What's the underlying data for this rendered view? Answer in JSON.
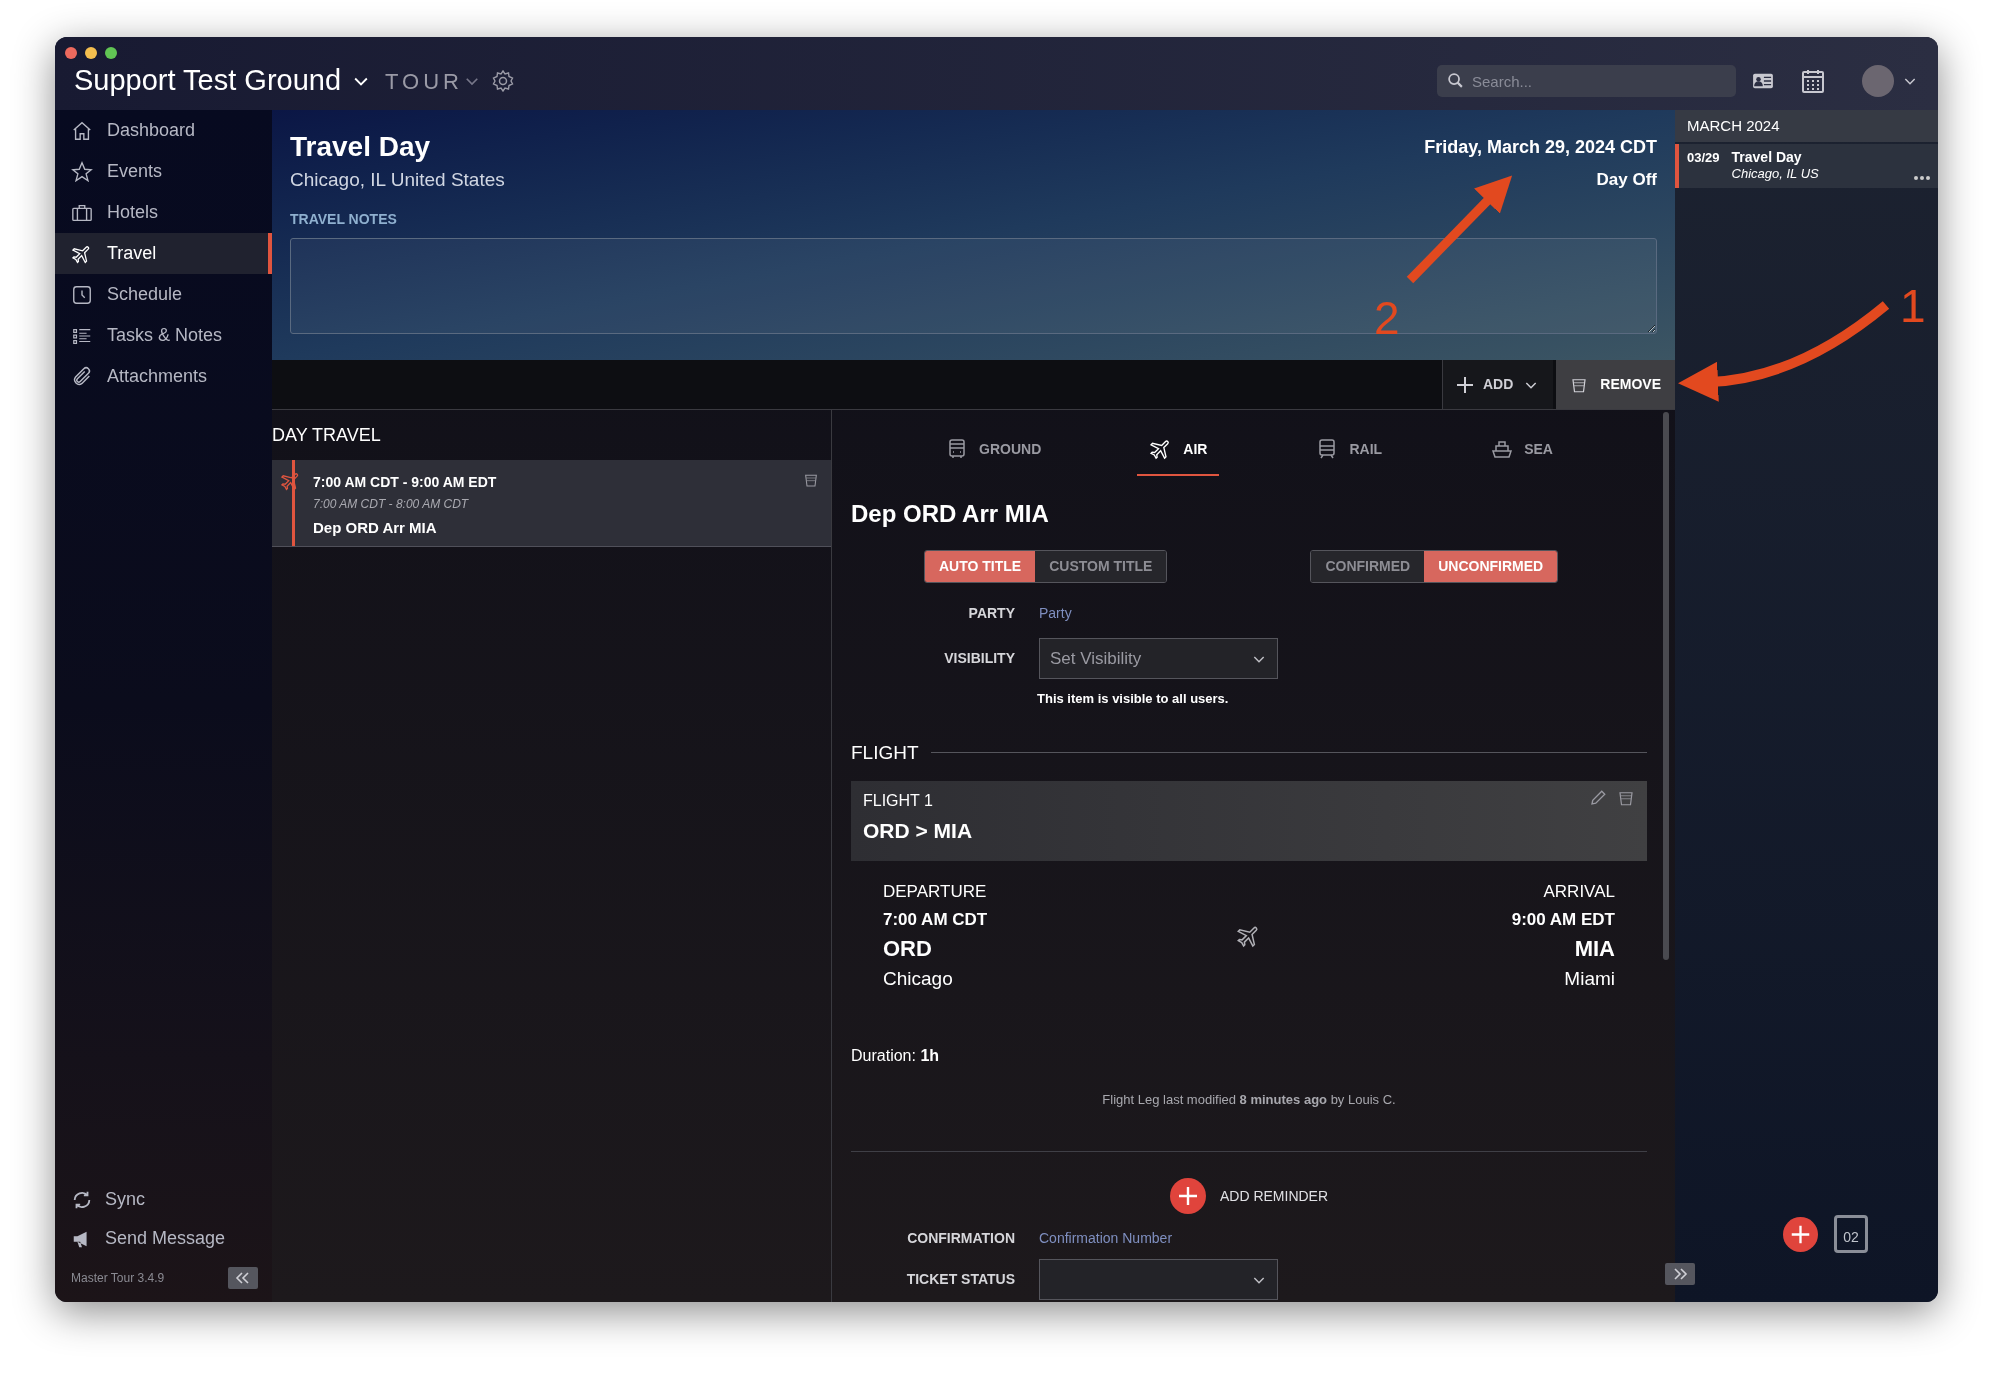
{
  "window": {
    "title": "Support Test Ground",
    "brand": "TOUR"
  },
  "search": {
    "placeholder": "Search..."
  },
  "sidebar": {
    "items": [
      {
        "label": "Dashboard",
        "kind": "home",
        "selected": false
      },
      {
        "label": "Events",
        "kind": "star",
        "selected": false
      },
      {
        "label": "Hotels",
        "kind": "suitcase",
        "selected": false
      },
      {
        "label": "Travel",
        "kind": "plane",
        "selected": true
      },
      {
        "label": "Schedule",
        "kind": "clock",
        "selected": false
      },
      {
        "label": "Tasks & Notes",
        "kind": "list",
        "selected": false
      },
      {
        "label": "Attachments",
        "kind": "clip",
        "selected": false
      }
    ],
    "footer_items": [
      {
        "label": "Sync",
        "kind": "sync"
      },
      {
        "label": "Send Message",
        "kind": "megaphone"
      }
    ],
    "version": "Master Tour 3.4.9"
  },
  "header": {
    "title": "Travel Day",
    "location": "Chicago, IL United States",
    "date": "Friday, March 29, 2024 CDT",
    "day_type": "Day Off",
    "notes_label": "TRAVEL NOTES"
  },
  "toolbar": {
    "add": "ADD",
    "remove": "REMOVE"
  },
  "day_travel": {
    "heading": "DAY TRAVEL",
    "items": [
      {
        "time": "7:00 AM CDT - 9:00 AM EDT",
        "local_time": "7:00 AM CDT - 8:00 AM CDT",
        "title": "Dep ORD Arr MIA",
        "selected": true
      }
    ]
  },
  "detail": {
    "tabs": [
      {
        "label": "GROUND",
        "kind": "bus",
        "selected": false
      },
      {
        "label": "AIR",
        "kind": "plane",
        "selected": true
      },
      {
        "label": "RAIL",
        "kind": "train",
        "selected": false
      },
      {
        "label": "SEA",
        "kind": "ship",
        "selected": false
      }
    ],
    "title": "Dep ORD Arr MIA",
    "title_modes": [
      {
        "label": "AUTO TITLE",
        "selected": true
      },
      {
        "label": "CUSTOM TITLE",
        "selected": false
      }
    ],
    "statuses": [
      {
        "label": "CONFIRMED",
        "selected": false
      },
      {
        "label": "UNCONFIRMED",
        "selected": true
      }
    ],
    "party": {
      "label": "PARTY",
      "placeholder": "Party"
    },
    "visibility": {
      "label": "VISIBILITY",
      "placeholder": "Set Visibility",
      "note": "This item is visible to all users."
    },
    "flight_heading": "FLIGHT",
    "flight": {
      "label": "FLIGHT 1",
      "route": "ORD > MIA",
      "departure": {
        "label": "DEPARTURE",
        "time": "7:00 AM CDT",
        "code": "ORD",
        "city": "Chicago"
      },
      "arrival": {
        "label": "ARRIVAL",
        "time": "9:00 AM EDT",
        "code": "MIA",
        "city": "Miami"
      }
    },
    "duration": "Duration: **1h**",
    "modified": "Flight Leg last modified **8 minutes ago** by Louis C.",
    "add_reminder": "ADD REMINDER",
    "confirmation": {
      "label": "CONFIRMATION",
      "placeholder": "Confirmation Number"
    },
    "ticket_status": {
      "label": "TICKET STATUS"
    }
  },
  "right_panel": {
    "month": "MARCH 2024",
    "events": [
      {
        "date": "03/29",
        "title": "Travel Day",
        "location": "Chicago, IL US"
      }
    ],
    "calendar_day": "02"
  },
  "annotations": [
    {
      "number": "2"
    },
    {
      "number": "1"
    }
  ]
}
